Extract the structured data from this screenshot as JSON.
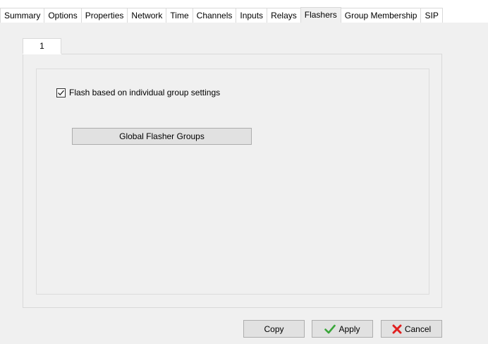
{
  "tabs": [
    {
      "label": "Summary"
    },
    {
      "label": "Options"
    },
    {
      "label": "Properties"
    },
    {
      "label": "Network"
    },
    {
      "label": "Time"
    },
    {
      "label": "Channels"
    },
    {
      "label": "Inputs"
    },
    {
      "label": "Relays"
    },
    {
      "label": "Flashers",
      "active": true
    },
    {
      "label": "Group Membership"
    },
    {
      "label": "SIP"
    }
  ],
  "inner_tab": {
    "label": "1"
  },
  "flasher": {
    "checkbox_label": "Flash based on individual group settings",
    "checkbox_checked": true,
    "global_groups_button": "Global Flasher Groups"
  },
  "footer": {
    "copy_label": "Copy",
    "apply_label": "Apply",
    "cancel_label": "Cancel",
    "apply_icon": "checkmark-icon",
    "cancel_icon": "x-icon",
    "apply_icon_color": "#3aa63a",
    "cancel_icon_color": "#e02020"
  }
}
